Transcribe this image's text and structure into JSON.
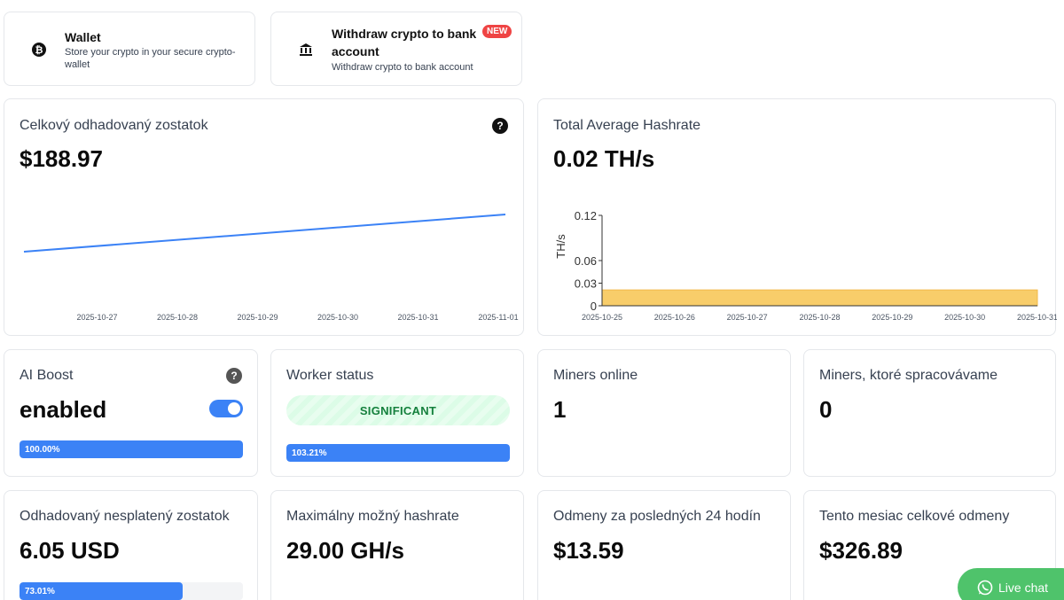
{
  "quick_actions": [
    {
      "title": "Wallet",
      "subtitle": "Store your crypto in your secure crypto-wallet",
      "icon": "bitcoin-icon"
    },
    {
      "title": "Withdraw crypto to bank account",
      "subtitle": "Withdraw crypto to bank account",
      "badge": "NEW",
      "icon": "bank-icon"
    }
  ],
  "balance_card": {
    "title": "Celkový odhadovaný zostatok",
    "value": "$188.97",
    "help": "?"
  },
  "hashrate_card": {
    "title": "Total Average Hashrate",
    "value": "0.02 TH/s"
  },
  "ai_boost": {
    "title": "AI Boost",
    "value": "enabled",
    "help": "?",
    "toggle_on": true,
    "progress_pct": 100.0,
    "progress_label": "100.00%"
  },
  "worker_status": {
    "title": "Worker status",
    "status": "SIGNIFICANT",
    "progress_pct": 103.21,
    "progress_label": "103.21%"
  },
  "miners_online": {
    "title": "Miners online",
    "value": "1"
  },
  "miners_processing": {
    "title": "Miners, ktoré spracovávame",
    "value": "0"
  },
  "unpaid_balance": {
    "title": "Odhadovaný nesplatený zostatok",
    "value": "6.05 USD",
    "progress_pct": 73.01,
    "progress_label": "73.01%"
  },
  "max_hashrate": {
    "title": "Maximálny možný hashrate",
    "value": "29.00 GH/s"
  },
  "rewards_24h": {
    "title": "Odmeny za posledných 24 hodín",
    "value": "$13.59"
  },
  "month_rewards": {
    "title": "Tento mesiac celkové odmeny",
    "value": "$326.89"
  },
  "live_chat": {
    "label": "Live chat"
  },
  "colors": {
    "accent_blue": "#3b82f6",
    "status_green": "#15803d",
    "bar_yellow": "#f8cd6a",
    "chat_green": "#4fc36b",
    "badge_red": "#ef4444"
  },
  "chart_data": [
    {
      "type": "line",
      "categories": [
        "2025-10-27",
        "2025-10-28",
        "2025-10-29",
        "2025-10-30",
        "2025-10-31",
        "2025-11-01"
      ],
      "series": [
        {
          "x": [
            "2025-10-26",
            "2025-11-01"
          ],
          "values": [
            172,
            188.97
          ]
        }
      ],
      "xlabel": "",
      "ylabel": "",
      "grid": false
    },
    {
      "type": "area",
      "categories": [
        "2025-10-25",
        "2025-10-26",
        "2025-10-27",
        "2025-10-28",
        "2025-10-29",
        "2025-10-30",
        "2025-10-31"
      ],
      "series": [
        {
          "values": [
            0.021,
            0.021,
            0.021,
            0.021,
            0.021,
            0.021,
            0.021
          ]
        }
      ],
      "yticks": [
        "0",
        "0.03",
        "0.06",
        "0.12"
      ],
      "ylabel": "TH/s",
      "ylim": [
        0,
        0.12
      ],
      "grid": false
    }
  ]
}
